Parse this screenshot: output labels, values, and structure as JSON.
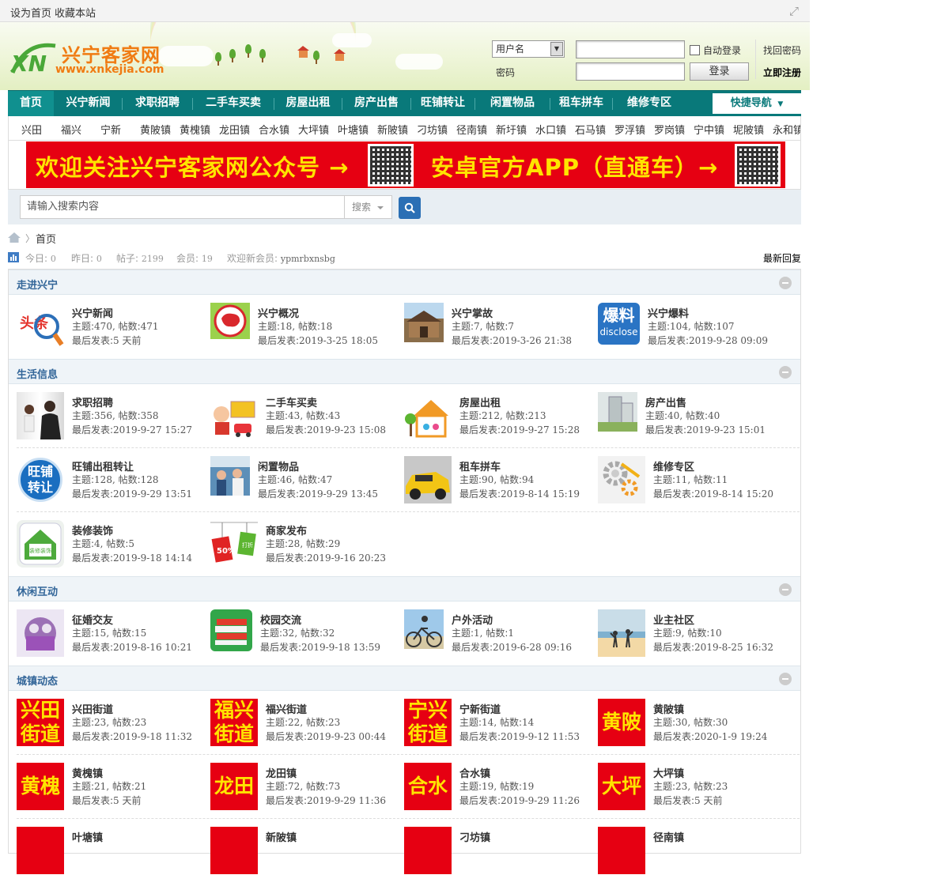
{
  "topbar": {
    "set_home": "设为首页",
    "bookmark": "收藏本站"
  },
  "brand": {
    "name": "兴宁客家网",
    "url": "www.xnkejia.com",
    "mark": "XN"
  },
  "login": {
    "user_type": "用户名",
    "password_label": "密码",
    "auto_login": "自动登录",
    "login_btn": "登录",
    "find_password": "找回密码",
    "register": "立即注册"
  },
  "nav": {
    "items": [
      "首页",
      "兴宁新闻",
      "求职招聘",
      "二手车买卖",
      "房屋出租",
      "房产出售",
      "旺铺转让",
      "闲置物品",
      "租车拼车",
      "维修专区"
    ],
    "quick": "快捷导航"
  },
  "towns": [
    "兴田",
    "福兴",
    "宁新",
    "黄陂镇",
    "黄槐镇",
    "龙田镇",
    "合水镇",
    "大坪镇",
    "叶塘镇",
    "新陂镇",
    "刁坊镇",
    "径南镇",
    "新圩镇",
    "水口镇",
    "石马镇",
    "罗浮镇",
    "罗岗镇",
    "宁中镇",
    "坭陂镇",
    "永和镇"
  ],
  "banner": {
    "text1": "欢迎关注兴宁客家网公众号 →",
    "text2": "安卓官方APP（直通车）→"
  },
  "search": {
    "placeholder": "请输入搜索内容",
    "type": "搜索"
  },
  "breadcrumb": {
    "current": "首页"
  },
  "stats": {
    "today_label": "今日:",
    "today": "0",
    "yesterday_label": "昨日:",
    "yesterday": "0",
    "posts_label": "帖子:",
    "posts": "2199",
    "members_label": "会员:",
    "members": "19",
    "welcome_label": "欢迎新会员:",
    "newest": "ypmrbxnsbg",
    "latest_reply": "最新回复"
  },
  "labels": {
    "topics": "主题:",
    "posts": "帖数:",
    "last": "最后发表:"
  },
  "categories": [
    {
      "title": "走进兴宁",
      "boards": [
        {
          "name": "兴宁新闻",
          "topics": "470,",
          "posts": "471",
          "last": "5 天前"
        },
        {
          "name": "兴宁概况",
          "topics": "18,",
          "posts": "18",
          "last": "2019-3-25 18:05"
        },
        {
          "name": "兴宁掌故",
          "topics": "7,",
          "posts": "7",
          "last": "2019-3-26 21:38"
        },
        {
          "name": "兴宁爆料",
          "topics": "104,",
          "posts": "107",
          "last": "2019-9-28 09:09"
        }
      ]
    },
    {
      "title": "生活信息",
      "boards": [
        {
          "name": "求职招聘",
          "topics": "356,",
          "posts": "358",
          "last": "2019-9-27 15:27"
        },
        {
          "name": "二手车买卖",
          "topics": "43,",
          "posts": "43",
          "last": "2019-9-23 15:08"
        },
        {
          "name": "房屋出租",
          "topics": "212,",
          "posts": "213",
          "last": "2019-9-27 15:28"
        },
        {
          "name": "房产出售",
          "topics": "40,",
          "posts": "40",
          "last": "2019-9-23 15:01"
        },
        {
          "name": "旺铺出租转让",
          "topics": "128,",
          "posts": "128",
          "last": "2019-9-29 13:51"
        },
        {
          "name": "闲置物品",
          "topics": "46,",
          "posts": "47",
          "last": "2019-9-29 13:45"
        },
        {
          "name": "租车拼车",
          "topics": "90,",
          "posts": "94",
          "last": "2019-8-14 15:19"
        },
        {
          "name": "维修专区",
          "topics": "11,",
          "posts": "11",
          "last": "2019-8-14 15:20"
        },
        {
          "name": "装修装饰",
          "topics": "4,",
          "posts": "5",
          "last": "2019-9-18 14:14"
        },
        {
          "name": "商家发布",
          "topics": "28,",
          "posts": "29",
          "last": "2019-9-16 20:23"
        }
      ]
    },
    {
      "title": "休闲互动",
      "boards": [
        {
          "name": "征婚交友",
          "topics": "15,",
          "posts": "15",
          "last": "2019-8-16 10:21"
        },
        {
          "name": "校园交流",
          "topics": "32,",
          "posts": "32",
          "last": "2019-9-18 13:59"
        },
        {
          "name": "户外活动",
          "topics": "1,",
          "posts": "1",
          "last": "2019-6-28 09:16"
        },
        {
          "name": "业主社区",
          "topics": "9,",
          "posts": "10",
          "last": "2019-8-25 16:32"
        }
      ]
    },
    {
      "title": "城镇动态",
      "boards": [
        {
          "name": "兴田街道",
          "topics": "23,",
          "posts": "23",
          "last": "2019-9-18 11:32",
          "icon_text": "兴田街道"
        },
        {
          "name": "福兴街道",
          "topics": "22,",
          "posts": "23",
          "last": "2019-9-23 00:44",
          "icon_text": "福兴街道"
        },
        {
          "name": "宁新街道",
          "topics": "14,",
          "posts": "14",
          "last": "2019-9-12 11:53",
          "icon_text": "宁兴街道"
        },
        {
          "name": "黄陂镇",
          "topics": "30,",
          "posts": "30",
          "last": "2020-1-9 19:24",
          "icon_text": "黄陂"
        },
        {
          "name": "黄槐镇",
          "topics": "21,",
          "posts": "21",
          "last": "5 天前",
          "icon_text": "黄槐"
        },
        {
          "name": "龙田镇",
          "topics": "72,",
          "posts": "73",
          "last": "2019-9-29 11:36",
          "icon_text": "龙田"
        },
        {
          "name": "合水镇",
          "topics": "19,",
          "posts": "19",
          "last": "2019-9-29 11:26",
          "icon_text": "合水"
        },
        {
          "name": "大坪镇",
          "topics": "23,",
          "posts": "23",
          "last": "5 天前",
          "icon_text": "大坪"
        },
        {
          "name": "叶塘镇"
        },
        {
          "name": "新陂镇"
        },
        {
          "name": "刁坊镇"
        },
        {
          "name": "径南镇"
        }
      ]
    }
  ],
  "icon_texts": {
    "news": "头条",
    "disclose_cn": "爆料",
    "disclose_en": "disclose",
    "shop_transfer": "旺铺转让",
    "promo_1": "50%",
    "promo_2": "打折",
    "decor": "装修装饰"
  }
}
